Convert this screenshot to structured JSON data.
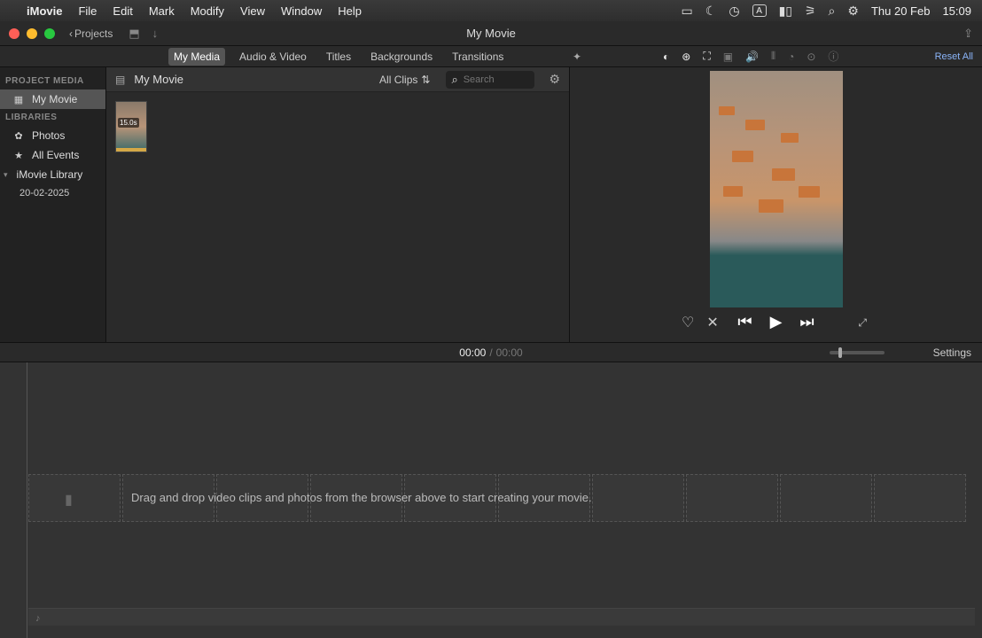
{
  "menubar": {
    "app_name": "iMovie",
    "items": [
      "File",
      "Edit",
      "Mark",
      "Modify",
      "View",
      "Window",
      "Help"
    ],
    "date": "Thu 20 Feb",
    "time": "15:09",
    "a_box": "A"
  },
  "window": {
    "back_label": "Projects",
    "title": "My Movie"
  },
  "tabs": {
    "items": [
      "My Media",
      "Audio & Video",
      "Titles",
      "Backgrounds",
      "Transitions"
    ],
    "active_index": 0,
    "reset_all": "Reset All"
  },
  "sidebar": {
    "project_media_header": "PROJECT MEDIA",
    "project_item": "My Movie",
    "libraries_header": "LIBRARIES",
    "photos": "Photos",
    "all_events": "All Events",
    "library": "iMovie Library",
    "date_event": "20-02-2025"
  },
  "browser": {
    "title": "My Movie",
    "filter": "All Clips",
    "search_placeholder": "Search",
    "clip_duration": "15.0s"
  },
  "timecode": {
    "current": "00:00",
    "sep": "/",
    "total": "00:00",
    "settings": "Settings"
  },
  "timeline": {
    "hint": "Drag and drop video clips and photos from the browser above to start creating your movie."
  }
}
